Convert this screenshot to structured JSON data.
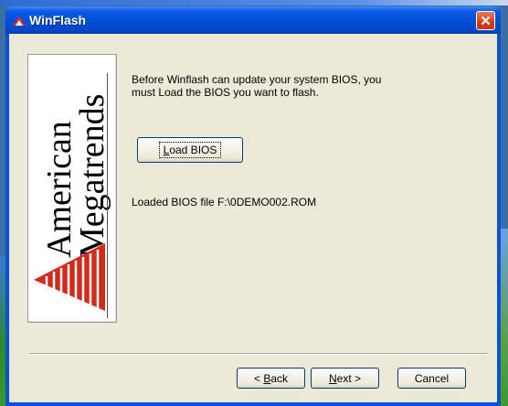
{
  "window": {
    "title": "WinFlash"
  },
  "logo": {
    "line1": "American",
    "line2": "Megatrends"
  },
  "main": {
    "description_line1": "Before Winflash can update your system BIOS, you",
    "description_line2": "must Load the BIOS you want to flash.",
    "load_button": {
      "accel": "L",
      "rest": "oad BIOS"
    },
    "loaded_file": "Loaded BIOS file F:\\0DEMO002.ROM"
  },
  "footer": {
    "back_button": {
      "prefix": "< ",
      "accel": "B",
      "rest": "ack"
    },
    "next_button": {
      "accel": "N",
      "rest": "ext >"
    },
    "cancel_button": "Cancel"
  },
  "colors": {
    "titlebar": "#0050d8",
    "client_bg": "#ece9d8",
    "close_button": "#d1421a"
  },
  "icons": {
    "title": "ami-logo-icon",
    "close": "close-icon"
  }
}
